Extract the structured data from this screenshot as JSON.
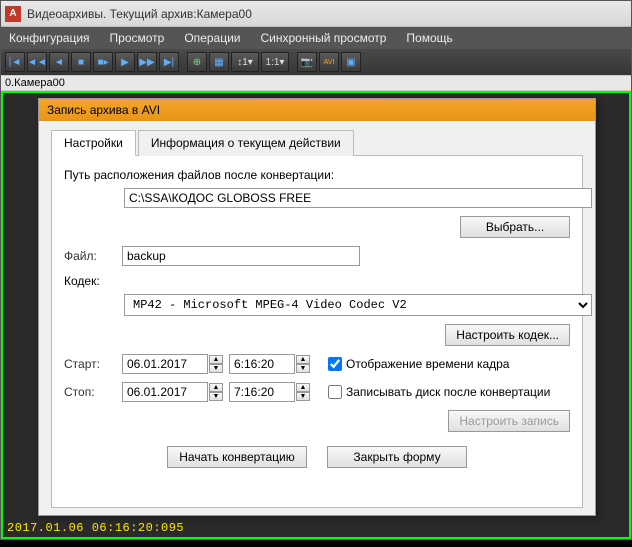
{
  "window": {
    "title": "Видеоархивы. Текущий архив:Камера00"
  },
  "menubar": [
    "Конфигурация",
    "Просмотр",
    "Операции",
    "Синхронный просмотр",
    "Помощь"
  ],
  "cambar": "0.Камера00",
  "dialog": {
    "title": "Запись архива в AVI",
    "tabs": {
      "settings": "Настройки",
      "log": "Информация о текущем действии"
    },
    "path_label": "Путь расположения файлов после конвертации:",
    "path": "C:\\SSA\\КОДОС GLOBOSS FREE",
    "browse": "Выбрать...",
    "file_label": "Файл:",
    "file": "backup",
    "codec_label": "Кодек:",
    "codec": "MP42 - Microsoft MPEG-4 Video Codec V2",
    "codec_btn": "Настроить кодек...",
    "start_label": "Старт:",
    "stop_label": "Стоп:",
    "start_date": "06.01.2017",
    "start_time": "6:16:20",
    "stop_date": "06.01.2017",
    "stop_time": "7:16:20",
    "chk_timestamp": "Отображение времени кадра",
    "chk_burn": "Записывать диск после конвертации",
    "rec_btn": "Настроить запись",
    "convert_btn": "Начать конвертацию",
    "close_btn": "Закрыть форму"
  },
  "timestamp": "2017.01.06 06:16:20:095"
}
